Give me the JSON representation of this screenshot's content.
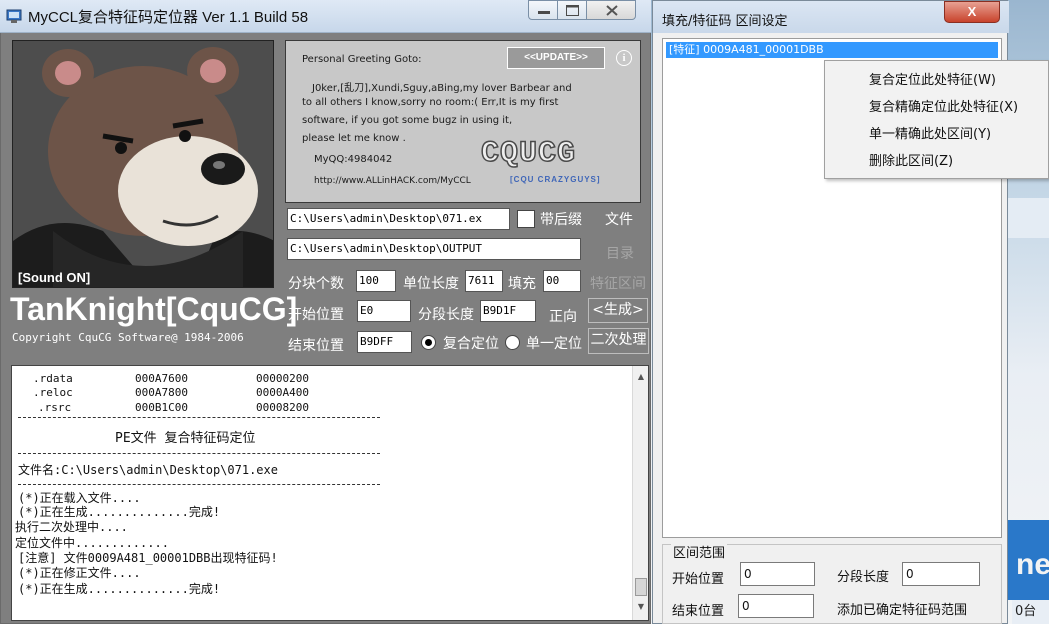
{
  "main_window": {
    "title": "MyCCL复合特征码定位器  Ver 1.1  Build 58",
    "sound_label": "[Sound ON]",
    "brand": "TanKnight[CquCG]",
    "copyright": "Copyright CquCG Software@ 1984-2006",
    "greeting": {
      "heading": "Personal Greeting Goto:",
      "update_label": "<<UPDATE>>",
      "info_glyph": "i",
      "lines": [
        "J0ker,[乱刀],Xundi,Sguy,aBing,my lover Barbear and",
        "to all others I know,sorry no room:(  Err,It is my first",
        "software, if you got some bugz in using it,",
        "please let me know .",
        "MyQQ:4984042",
        "http://www.ALLinHACK.com/MyCCL"
      ],
      "logo_text": "CQUCG",
      "logo_sub": "[CQU CRAZYGUYS]"
    },
    "file_path": "C:\\Users\\admin\\Desktop\\071.ex",
    "suffix_checkbox_label": "带后缀",
    "file_button": "文件",
    "output_path": "C:\\Users\\admin\\Desktop\\OUTPUT",
    "dir_button": "目录",
    "block_count_label": "分块个数",
    "block_count_value": "100",
    "unit_length_label": "单位长度",
    "unit_length_value": "7611",
    "fill_label": "填充",
    "fill_value": "00",
    "feature_range_button": "特征区间",
    "start_label": "开始位置",
    "start_value": "E0",
    "seg_length_label": "分段长度",
    "seg_length_value": "B9D1F",
    "direction_label": "正向",
    "generate_button": "<生成>",
    "end_label": "结束位置",
    "end_value": "B9DFF",
    "radio_composite_label": "复合定位",
    "radio_single_label": "单一定位",
    "second_process_button": "二次处理",
    "log": {
      "sections": [
        {
          "name": ".rdata",
          "addr": "000A7600",
          "size": "00000200"
        },
        {
          "name": ".reloc",
          "addr": "000A7800",
          "size": "0000A400"
        },
        {
          "name": ".rsrc",
          "addr": "000B1C00",
          "size": "00008200"
        }
      ],
      "heading": "PE文件 复合特征码定位",
      "filename_line": "文件名:C:\\Users\\admin\\Desktop\\071.exe",
      "lines": [
        "(*)正在载入文件....",
        "(*)正在生成..............完成!",
        "执行二次处理中....",
        "定位文件中.............",
        "[注意] 文件0009A481_00001DBB出现特征码!",
        "(*)正在修正文件....",
        "(*)正在生成..............完成!"
      ]
    }
  },
  "second_window": {
    "title": "填充/特征码 区间设定",
    "close_glyph": "X",
    "list_items": [
      "[特征] 0009A481_00001DBB"
    ],
    "range_group_label": "区间范围",
    "start_label": "开始位置",
    "start_value": "0",
    "seg_length_label": "分段长度",
    "seg_length_value": "0",
    "end_label": "结束位置",
    "end_value": "0",
    "add_confirmed_label": "添加已确定特征码范围"
  },
  "context_menu": {
    "items": [
      "复合定位此处特征(W)",
      "复合精确定位此处特征(X)",
      "单一精确此处区间(Y)",
      "删除此区间(Z)"
    ]
  },
  "desktop": {
    "partial_text": "ne",
    "partial_text2": "0台"
  }
}
